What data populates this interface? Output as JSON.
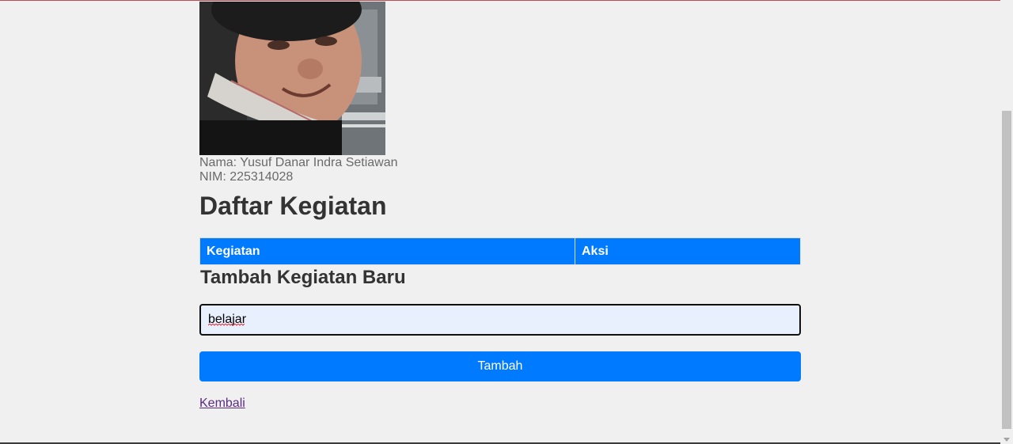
{
  "profile": {
    "name_line": "Nama: Yusuf Danar Indra Setiawan",
    "nim_line": "NIM: 225314028"
  },
  "main": {
    "title": "Daftar Kegiatan",
    "table": {
      "headers": [
        "Kegiatan",
        "Aksi"
      ],
      "rows": []
    },
    "form": {
      "title": "Tambah Kegiatan Baru",
      "input_value": "belajar",
      "submit_label": "Tambah"
    },
    "back_link": "Kembali"
  },
  "colors": {
    "accent": "#007bff",
    "background": "#f0f0f0",
    "heading": "#333333",
    "input_bg": "#e8f0fe"
  }
}
